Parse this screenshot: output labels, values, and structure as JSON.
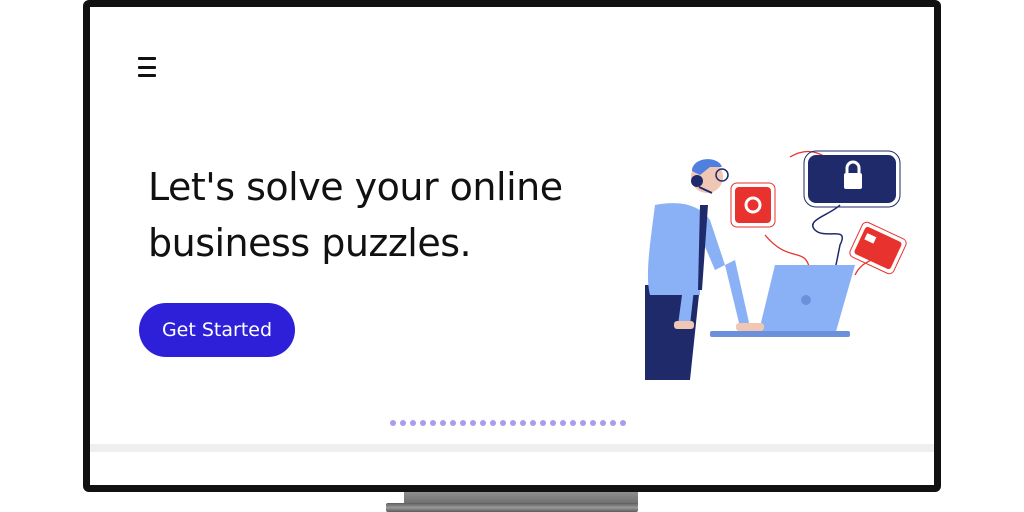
{
  "header": {
    "menu_icon": "hamburger-menu-icon"
  },
  "hero": {
    "headline_line1": "Let's solve your online",
    "headline_line2": "business puzzles.",
    "cta_label": "Get Started"
  },
  "carousel": {
    "dot_count": 24
  },
  "colors": {
    "primary": "#2d20d8",
    "navy": "#1f2a6b",
    "light_blue": "#8ab0f5",
    "red": "#e8322e",
    "dot": "#a99cf0"
  }
}
